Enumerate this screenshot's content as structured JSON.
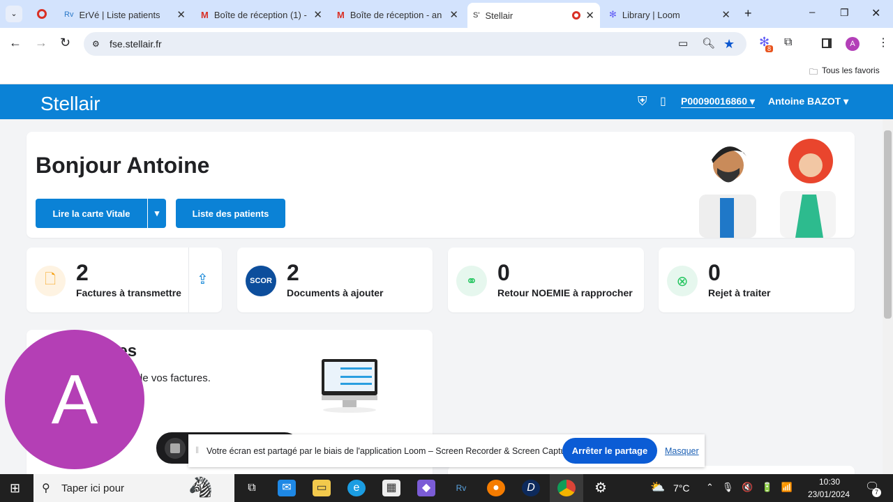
{
  "browser": {
    "tabs": [
      {
        "label": "ErVé | Liste patients",
        "icon": "rv-icon"
      },
      {
        "label": "Boîte de réception (1) -",
        "icon": "gmail-icon"
      },
      {
        "label": "Boîte de réception - an",
        "icon": "gmail-icon"
      },
      {
        "label": "Stellair",
        "icon": "stellair-icon",
        "active": true
      },
      {
        "label": "Library | Loom",
        "icon": "loom-icon"
      }
    ],
    "url": "fse.stellair.fr",
    "extension_badge": "8",
    "profile_initial": "A",
    "bookmarks_label": "Tous les favoris"
  },
  "header": {
    "logo": "Stellair",
    "account_id": "P00090016860",
    "user": "Antoine BAZOT"
  },
  "welcome": {
    "title": "Bonjour Antoine",
    "read_vitale": "Lire la carte Vitale",
    "patients_list": "Liste des patients"
  },
  "stats": [
    {
      "count": "2",
      "label": "Factures à transmettre",
      "color": "#f59e0b"
    },
    {
      "count": "2",
      "label": "Documents à ajouter",
      "icon_text": "SCOR"
    },
    {
      "count": "0",
      "label": "Retour NOEMIE à rapprocher",
      "color": "#22c55e"
    },
    {
      "count": "0",
      "label": "Rejet à traiter",
      "color": "#22c55e"
    }
  ],
  "invoices": {
    "title_partial": "res",
    "text_partial": "de vos factures."
  },
  "loom": {
    "avatar_initial": "A",
    "notice": "Votre écran est partagé par le biais de l'application Loom – Screen Recorder & Screen Capture.",
    "stop": "Arrêter le partage",
    "hide": "Masquer"
  },
  "taskbar": {
    "search_placeholder": "Taper ici pour",
    "weather": "7°C",
    "time": "10:30",
    "date": "23/01/2024",
    "notifications": "7"
  }
}
